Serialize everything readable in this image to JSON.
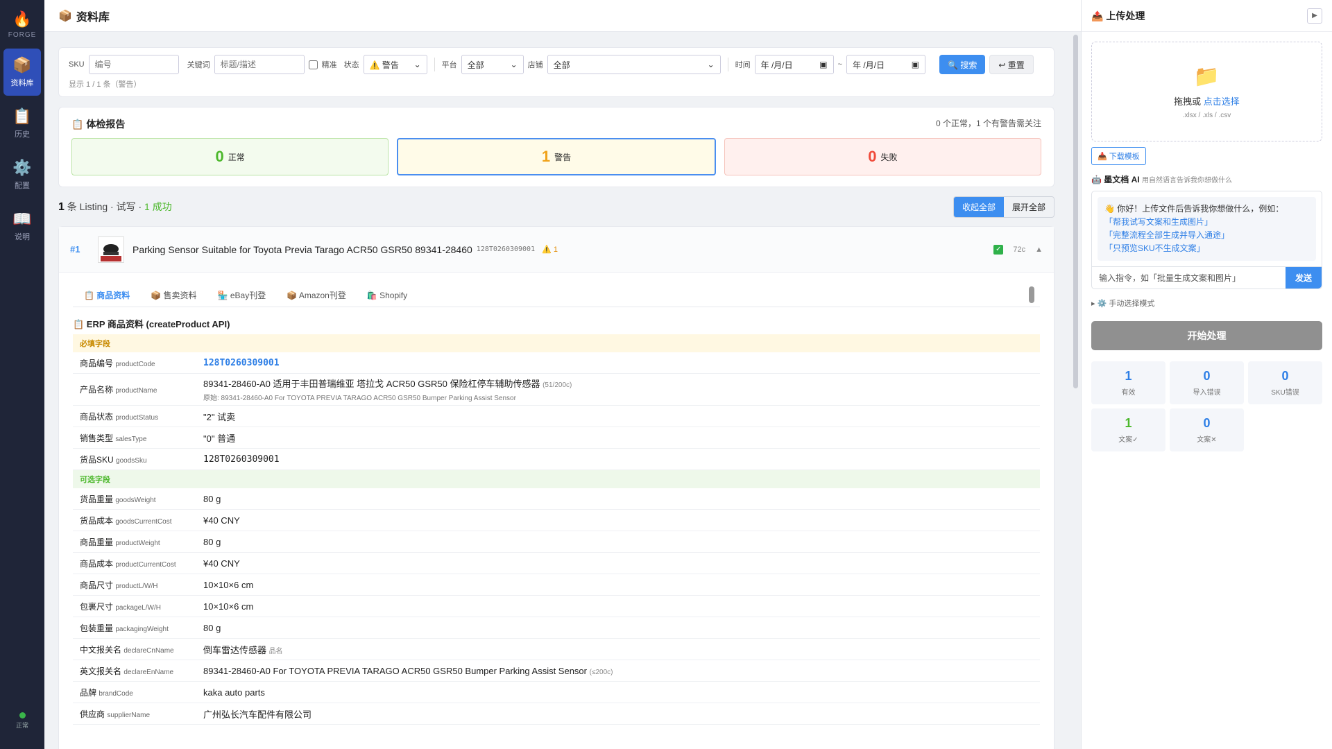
{
  "nav": {
    "brand": "FORGE",
    "items": [
      {
        "label": "资料库",
        "icon": "📦"
      },
      {
        "label": "历史",
        "icon": "📋"
      },
      {
        "label": "配置",
        "icon": "⚙️"
      },
      {
        "label": "说明",
        "icon": "📖"
      }
    ],
    "status": "正常"
  },
  "header": {
    "icon": "📦",
    "title": "资料库"
  },
  "filter": {
    "sku_label": "SKU",
    "sku_placeholder": "编号",
    "kw_label": "关键词",
    "kw_placeholder": "标题/描述",
    "exact_label": "精准",
    "status_label": "状态",
    "status_value": "⚠️ 警告",
    "platform_label": "平台",
    "platform_value": "全部",
    "store_label": "店铺",
    "store_value": "全部",
    "time_label": "时间",
    "date_from": "年 /月/日",
    "date_sep": "~",
    "date_to": "年 /月/日",
    "search": "🔍 搜索",
    "reset": "↩ 重置",
    "hint": "显示 1 / 1 条（警告）"
  },
  "health": {
    "title": "📋 体检报告",
    "summary": "0 个正常，1 个有警告需关注",
    "ok_n": "0",
    "ok_l": "正常",
    "warn_n": "1",
    "warn_l": "警告",
    "fail_n": "0",
    "fail_l": "失败"
  },
  "listhead": {
    "count": "1",
    "text1": " 条 Listing · 试写 · ",
    "succ": "1 成功",
    "collapse": "收起全部",
    "expand": "展开全部"
  },
  "listing": {
    "num": "#1",
    "thumb_label": "原图",
    "title": "Parking Sensor Suitable for Toyota Previa Tarago ACR50 GSR50 89341-28460",
    "code": "128T0260309001",
    "warn": "⚠️ 1",
    "chars": "72c",
    "tabs": [
      "📋 商品资料",
      "📦 售卖资料",
      "🏪 eBay刊登",
      "📦 Amazon刊登",
      "🛍️ Shopify"
    ],
    "section_title": "📋 ERP 商品资料 (createProduct API)",
    "required_label": "必填字段",
    "optional_label": "可选字段",
    "required": [
      {
        "cn": "商品编号",
        "en": "productCode",
        "val": "128T0260309001"
      },
      {
        "cn": "产品名称",
        "en": "productName",
        "val": "89341-28460-A0 适用于丰田普瑞维亚 塔拉戈 ACR50 GSR50 保险杠停车辅助传感器",
        "sub": "(51/200c)",
        "orig": "原始: 89341-28460-A0 For TOYOTA PREVIA TARAGO ACR50 GSR50 Bumper Parking Assist Sensor"
      },
      {
        "cn": "商品状态",
        "en": "productStatus",
        "val": "\"2\" 试卖"
      },
      {
        "cn": "销售类型",
        "en": "salesType",
        "val": "\"0\" 普通"
      },
      {
        "cn": "货品SKU",
        "en": "goodsSku",
        "val": "128T0260309001"
      }
    ],
    "optional": [
      {
        "cn": "货品重量",
        "en": "goodsWeight",
        "val": "80 g"
      },
      {
        "cn": "货品成本",
        "en": "goodsCurrentCost",
        "val": "¥40 CNY"
      },
      {
        "cn": "商品重量",
        "en": "productWeight",
        "val": "80 g"
      },
      {
        "cn": "商品成本",
        "en": "productCurrentCost",
        "val": "¥40 CNY"
      },
      {
        "cn": "商品尺寸",
        "en": "productL/W/H",
        "val": "10×10×6 cm"
      },
      {
        "cn": "包裹尺寸",
        "en": "packageL/W/H",
        "val": "10×10×6 cm"
      },
      {
        "cn": "包装重量",
        "en": "packagingWeight",
        "val": "80 g"
      },
      {
        "cn": "中文报关名",
        "en": "declareCnName",
        "val": "倒车雷达传感器",
        "sub": "品名"
      },
      {
        "cn": "英文报关名",
        "en": "declareEnName",
        "val": "89341-28460-A0 For TOYOTA PREVIA TARAGO ACR50 GSR50 Bumper Parking Assist Sensor",
        "sub": "(≤200c)"
      },
      {
        "cn": "品牌",
        "en": "brandCode",
        "val": "kaka auto parts"
      },
      {
        "cn": "供应商",
        "en": "supplierName",
        "val": "广州弘长汽车配件有限公司"
      }
    ]
  },
  "side": {
    "title": "📤 上传处理",
    "play": "▶",
    "drop_icon": "📁",
    "drop_text": "拖拽或 ",
    "drop_link": "点击选择",
    "drop_ext": ".xlsx / .xls / .csv",
    "download": "📥 下载模板",
    "ai_title": "🤖 墨文档 AI",
    "ai_sub": "用自然语言告诉我你想做什么",
    "ai_greet": "👋 你好！上传文件后告诉我你想做什么，例如：",
    "ai_q1": "「帮我试写文案和生成图片」",
    "ai_q2": "「完整流程全部生成并导入通途」",
    "ai_q3": "「只预览SKU不生成文案」",
    "ai_placeholder": "输入指令，如「批量生成文案和图片」",
    "send": "发送",
    "manual": "▸ ⚙️ 手动选择模式",
    "start": "开始处理",
    "stats": [
      {
        "n": "1",
        "l": "有效"
      },
      {
        "n": "0",
        "l": "导入错误"
      },
      {
        "n": "0",
        "l": "SKU错误"
      },
      {
        "n": "1",
        "l": "文案✓"
      },
      {
        "n": "0",
        "l": "文案✕"
      }
    ]
  }
}
